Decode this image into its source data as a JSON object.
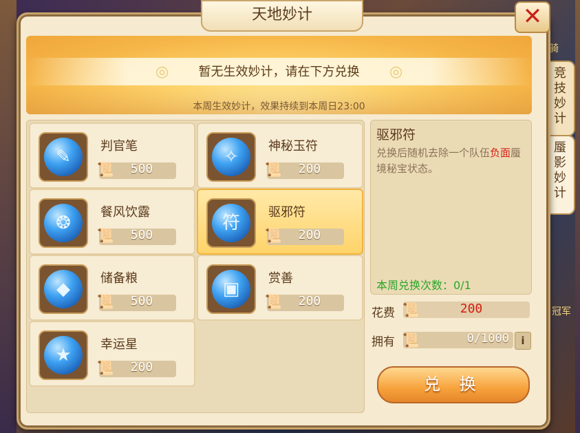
{
  "window": {
    "title": "天地妙计",
    "close_label": "✕"
  },
  "banner": {
    "message": "暂无生效妙计，请在下方兑换",
    "subtext": "本周生效妙计，效果持续到本周日23:00"
  },
  "items": [
    {
      "name": "判官笔",
      "price": "500",
      "icon": "brush-icon",
      "glyph": "✎"
    },
    {
      "name": "神秘玉符",
      "price": "200",
      "icon": "jade-talisman-icon",
      "glyph": "✧"
    },
    {
      "name": "餐风饮露",
      "price": "500",
      "icon": "dew-icon",
      "glyph": "❂"
    },
    {
      "name": "驱邪符",
      "price": "200",
      "icon": "exorcism-talisman-icon",
      "glyph": "符"
    },
    {
      "name": "储备粮",
      "price": "500",
      "icon": "grain-sack-icon",
      "glyph": "◆"
    },
    {
      "name": "赏善",
      "price": "200",
      "icon": "gift-box-icon",
      "glyph": "▣"
    },
    {
      "name": "幸运星",
      "price": "200",
      "icon": "lucky-star-icon",
      "glyph": "★"
    }
  ],
  "selected_index": 3,
  "detail": {
    "title": "驱邪符",
    "desc_before": "兑换后随机去除一个队伍",
    "desc_highlight": "负面",
    "desc_after": "蜃境秘宝状态。",
    "weekly_count": "本周兑换次数：0/1"
  },
  "cost": {
    "label": "花费",
    "value": "200"
  },
  "owned": {
    "label": "拥有",
    "value": "0/1000",
    "info": "i"
  },
  "exchange_button": "兑 换",
  "side_tabs": [
    {
      "label": "竞技妙计"
    },
    {
      "label": "蜃影妙计"
    }
  ],
  "background_text": [
    "骑",
    "冠军"
  ],
  "colors": {
    "accent": "#f7a33c",
    "highlight_red": "#d8201a",
    "count_green": "#2aa62a",
    "currency_blue": "#2f7fe0"
  }
}
